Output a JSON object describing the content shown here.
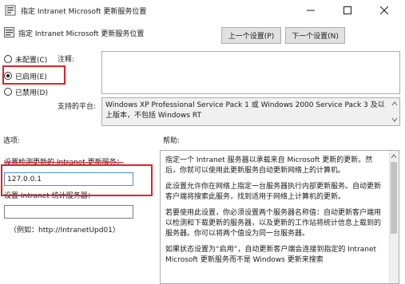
{
  "window": {
    "title": "指定 Intranet Microsoft 更新服务位置"
  },
  "header": {
    "title": "指定 Intranet Microsoft 更新服务位置",
    "prev_label": "上一个设置(P)",
    "next_label": "下一个设置(N)"
  },
  "state": {
    "options": [
      {
        "label": "未配置(C)",
        "checked": false
      },
      {
        "label": "已启用(E)",
        "checked": true
      },
      {
        "label": "已禁用(D)",
        "checked": false
      }
    ],
    "comment_label": "注释:",
    "comment_value": "",
    "platform_label": "支持的平台:",
    "platform_value": "Windows XP Professional Service Pack 1 或 Windows 2000 Service Pack 3 及以上版本，不包括 Windows RT"
  },
  "options_panel": {
    "heading": "选项:",
    "update_service_label": "设置检测更新的 Intranet 更新服务：",
    "update_service_value": "127.0.0.1",
    "stats_server_label": "设置 Intranet 统计服务器：",
    "stats_server_value": "",
    "example": "（例如：http://IntranetUpd01）"
  },
  "help_panel": {
    "heading": "帮助:",
    "paragraphs": [
      "指定一个 Intranet 服务器以承载来自 Microsoft 更新的更新。然后，你就可以使用此更新服务自动更新网络上的计算机。",
      "此设置允许你在网络上指定一台服务器执行内部更新服务。自动更新客户端将搜索此服务，找到适用于网络上计算机的更新。",
      "若要使用此设置，你必须设置两个服务器名称值：自动更新客户端用以检测和下载更新的服务器，以及更新的工作站将统计信息上载到的服务器。你可以将两个值设为同一台服务器。",
      "如果状态设置为“启用”，自动更新客户端会连接到指定的 Intranet Microsoft 更新服务而不是 Windows 更新来搜索"
    ]
  },
  "colors": {
    "highlight": "#e0232b",
    "button_face": "#e1e1e1",
    "focus_border": "#4a90d9"
  },
  "icons": [
    "policy-icon",
    "minimize-icon",
    "maximize-icon",
    "close-icon",
    "settings-icon"
  ]
}
